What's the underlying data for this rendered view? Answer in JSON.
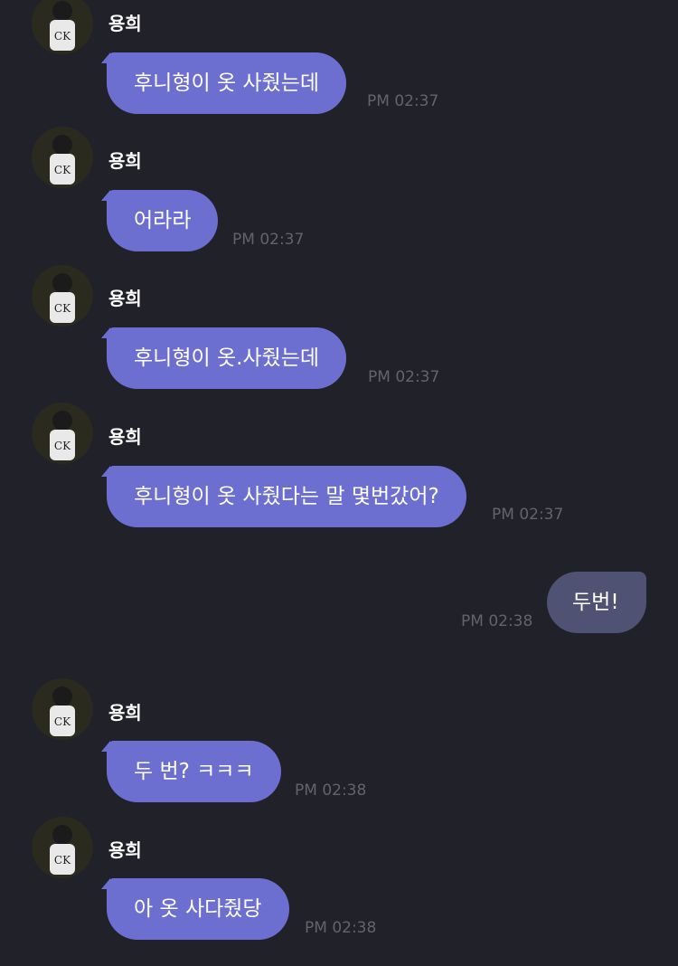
{
  "colors": {
    "background": "#21212a",
    "incoming_bubble": "#6c6fcf",
    "outgoing_bubble": "#4f5272",
    "timestamp": "#62636d",
    "text": "#ffffff"
  },
  "messages": [
    {
      "sender": "용희",
      "text": "후니형이 옷 사줬는데",
      "time": "PM 02:37",
      "direction": "incoming"
    },
    {
      "sender": "용희",
      "text": "어라라",
      "time": "PM 02:37",
      "direction": "incoming"
    },
    {
      "sender": "용희",
      "text": "후니형이 옷.사줬는데",
      "time": "PM 02:37",
      "direction": "incoming"
    },
    {
      "sender": "용희",
      "text": "후니형이 옷 사줬다는 말 몇번갔어?",
      "time": "PM 02:37",
      "direction": "incoming"
    },
    {
      "text": "두번!",
      "time": "PM 02:38",
      "direction": "outgoing"
    },
    {
      "sender": "용희",
      "text": "두 번? ㅋㅋㅋ",
      "time": "PM 02:38",
      "direction": "incoming"
    },
    {
      "sender": "용희",
      "text": "아 옷 사다줬당",
      "time": "PM 02:38",
      "direction": "incoming"
    }
  ]
}
